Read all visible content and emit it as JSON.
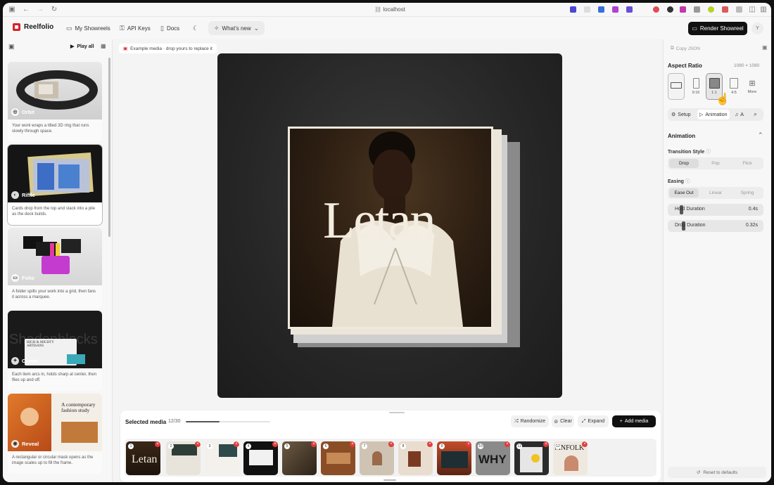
{
  "browser": {
    "url": "localhost"
  },
  "header": {
    "app_name": "Reelfolio",
    "nav": [
      {
        "label": "My Showreels",
        "icon": "film-icon"
      },
      {
        "label": "API Keys",
        "icon": "key-icon"
      },
      {
        "label": "Docs",
        "icon": "book-icon"
      }
    ],
    "whats_new": "What's new",
    "render_button": "Render Showreel",
    "avatar_initial": "Y"
  },
  "sidebar": {
    "play_all": "Play all",
    "presets": [
      {
        "name": "Orbit",
        "description": "Your work wraps a tilted 3D ring that runs slowly through space."
      },
      {
        "name": "Riffle",
        "description": "Cards drop from the top and stack into a pile as the deck builds."
      },
      {
        "name": "Folio",
        "description": "A folder spills your work into a grid, then fans it across a marquee."
      },
      {
        "name": "Comet",
        "description": "Each item arcs in, holds sharp at center, then flies up and off."
      },
      {
        "name": "Reveal",
        "description": "A rectangular or circular mask opens as the image scales up to fill the frame."
      }
    ],
    "preview_texts": {
      "comet_big": "Shadenblocks",
      "comet_card": "HIGH & MIGHTY\nARTISANS",
      "reveal_heading": "A contemporary fashion study"
    }
  },
  "canvas": {
    "hint": "Example media · drop yours to replace it",
    "photo_word": "Letan"
  },
  "tray": {
    "title": "Selected media",
    "count": "12/30",
    "progress": 0.4,
    "buttons": {
      "randomize": "Randomize",
      "clear": "Clear",
      "expand": "Expand",
      "add_media": "Add media"
    },
    "items": [
      {
        "n": "1",
        "text": "Letan"
      },
      {
        "n": "2",
        "text": ""
      },
      {
        "n": "3",
        "text": ""
      },
      {
        "n": "4",
        "text": ""
      },
      {
        "n": "5",
        "text": ""
      },
      {
        "n": "6",
        "text": ""
      },
      {
        "n": "7",
        "text": ""
      },
      {
        "n": "8",
        "text": ""
      },
      {
        "n": "9",
        "text": ""
      },
      {
        "n": "10",
        "text": "WHY"
      },
      {
        "n": "11",
        "text": ""
      },
      {
        "n": "12",
        "text": "MNFOLK"
      }
    ]
  },
  "panel": {
    "copy_json": "Copy JSON",
    "aspect_ratio_title": "Aspect Ratio",
    "dimensions": "1080 × 1080",
    "ratios": [
      {
        "label": ""
      },
      {
        "label": "9:16"
      },
      {
        "label": "1:1"
      },
      {
        "label": "4:5"
      },
      {
        "label": "More"
      }
    ],
    "tabs": [
      "Setup",
      "Animation",
      "A"
    ],
    "animation_title": "Animation",
    "transition_label": "Transition Style",
    "transitions": [
      "Drop",
      "Pop",
      "Flick"
    ],
    "easing_label": "Easing",
    "easings": [
      "Ease Out",
      "Linear",
      "Spring"
    ],
    "hold_duration": {
      "label": "Hold Duration",
      "value": "0.4s"
    },
    "drop_duration": {
      "label": "Drop Duration",
      "value": "0.32s"
    },
    "reset": "Reset to defaults"
  }
}
